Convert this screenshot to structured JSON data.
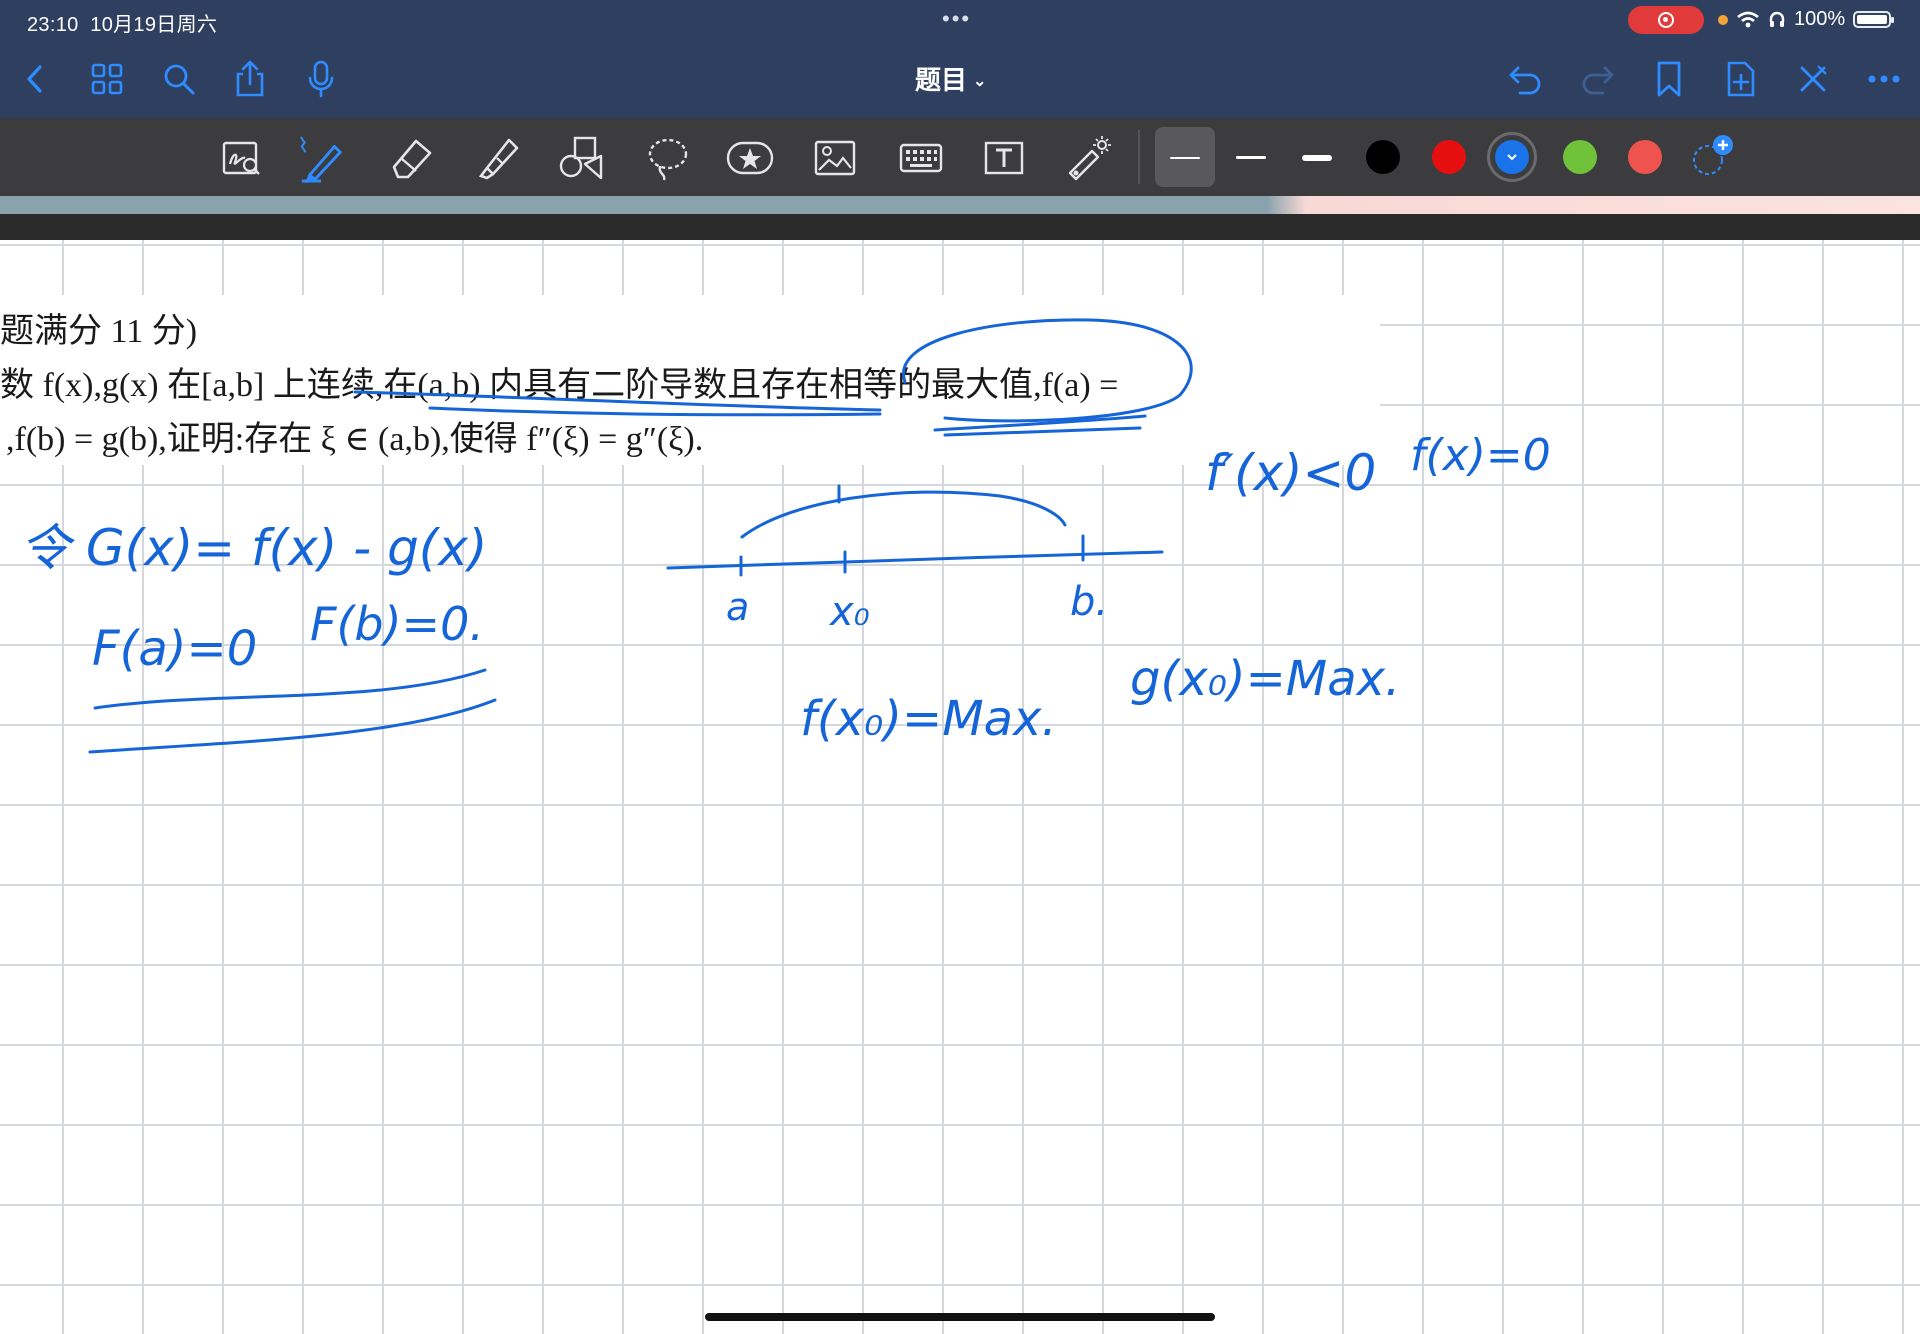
{
  "status": {
    "time": "23:10",
    "date": "10月19日周六",
    "battery": "100%",
    "center_dots": "•••"
  },
  "nav": {
    "title": "题目",
    "title_chevron": "⌄"
  },
  "toolbar": {
    "colors": [
      "#000000",
      "#e50f0f",
      "#1a73e8",
      "#6fc23a",
      "#ef5350"
    ],
    "selected_color": "#1a73e8",
    "thickness_levels": 3,
    "selected_thickness": 1
  },
  "problem": {
    "line1": "题满分 11 分)",
    "line2": "数 f(x),g(x) 在[a,b] 上连续,在(a,b) 内具有二阶导数且存在相等的最大值,f(a) =",
    "line3": ",f(b) = g(b),证明:存在 ξ ∈ (a,b),使得 f″(ξ) = g″(ξ)."
  },
  "handwriting": {
    "h1": "令 G(x)= f(x) - g(x)",
    "h2": "F(a)=0",
    "h3": "F(b)=0.",
    "axis_a": "a",
    "axis_x0": "x₀",
    "axis_b": "b.",
    "h4": "f(x₀)=Max.",
    "h5": "g(x₀)=Max.",
    "h6": "f′(x)<0",
    "h7": "f(x)=0"
  }
}
